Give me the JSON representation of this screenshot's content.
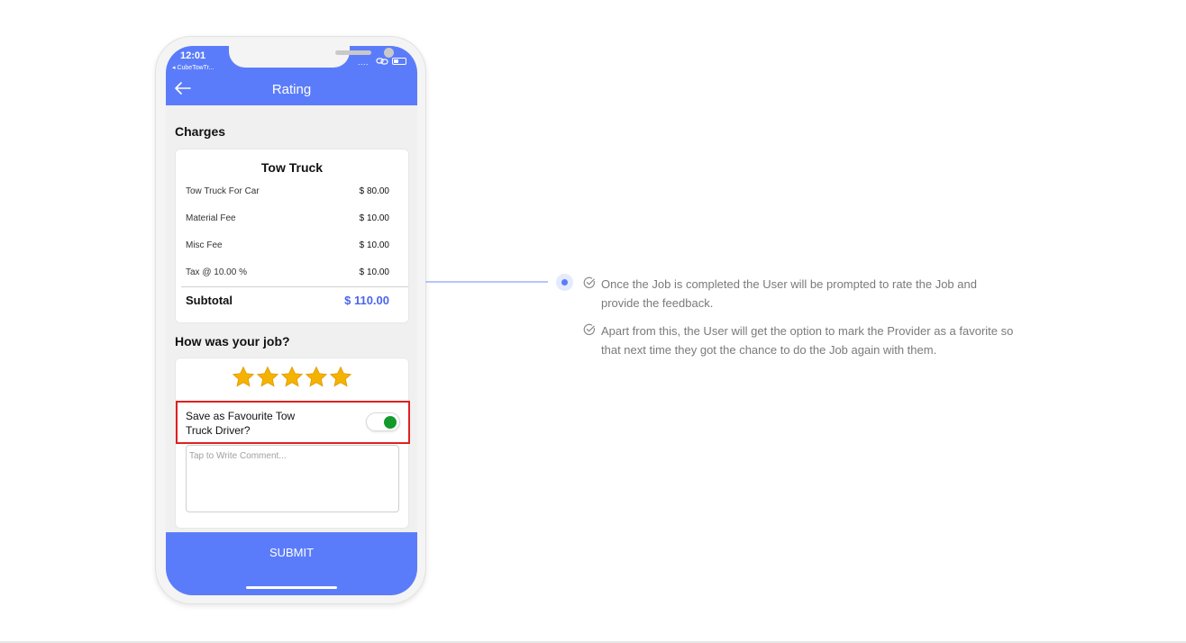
{
  "status_bar": {
    "time": "12:01",
    "back_app": "◂ CubeTowTr..."
  },
  "appbar": {
    "title": "Rating"
  },
  "charges": {
    "section_title": "Charges",
    "card_title": "Tow Truck",
    "items": [
      {
        "label": "Tow Truck For Car",
        "value": "$ 80.00"
      },
      {
        "label": "Material Fee",
        "value": "$ 10.00"
      },
      {
        "label": "Misc Fee",
        "value": "$ 10.00"
      },
      {
        "label": "Tax @ 10.00 %",
        "value": "$ 10.00"
      }
    ],
    "subtotal_label": "Subtotal",
    "subtotal_value": "$ 110.00"
  },
  "rating": {
    "section_title": "How was your job?",
    "stars": 5,
    "favourite_label": "Save as Favourite Tow Truck Driver?",
    "favourite_on": true,
    "comment_placeholder": "Tap to Write Comment..."
  },
  "submit_label": "SUBMIT",
  "notes": [
    "Once the Job is completed the User will be prompted to rate the Job and provide the feedback.",
    "Apart from this, the User will get the option to mark the Provider as a favorite so that next time they got the chance to do the Job again with them."
  ],
  "colors": {
    "primary": "#5b7cfa",
    "accent_price": "#4a64ee",
    "highlight": "#e02020",
    "toggle_on": "#129a2a",
    "star": "#f5b301"
  }
}
